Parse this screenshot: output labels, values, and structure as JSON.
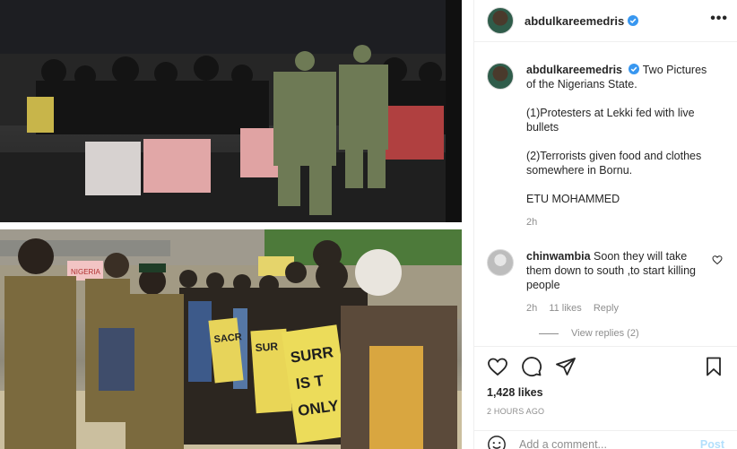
{
  "post": {
    "username": "abdulkareemedris",
    "caption_intro": "Two Pictures of the Nigerians State.",
    "caption_p1": "(1)Protesters at Lekki fed with live bullets",
    "caption_p2": "(2)Terrorists given food and clothes somewhere in Bornu.",
    "caption_p3": "ETU MOHAMMED",
    "caption_time": "2h",
    "likes": "1,428 likes",
    "posted": "2 HOURS AGO"
  },
  "comment": {
    "username": "chinwambia",
    "text": "Soon they will take them down to south ,to start killing people",
    "time": "2h",
    "likes": "11 likes",
    "reply": "Reply",
    "view_replies": "View replies (2)"
  },
  "composer": {
    "placeholder": "Add a comment...",
    "post_label": "Post"
  },
  "signs": {
    "left": "NIGERIA",
    "mid1": "SACR",
    "mid2": "SUR",
    "main1": "SURR",
    "main2": "IS T",
    "main3": "ONLY"
  },
  "colors": {
    "verified": "#3897f0",
    "post_disabled": "#b2dffc",
    "camo": "#7b6a3e"
  }
}
